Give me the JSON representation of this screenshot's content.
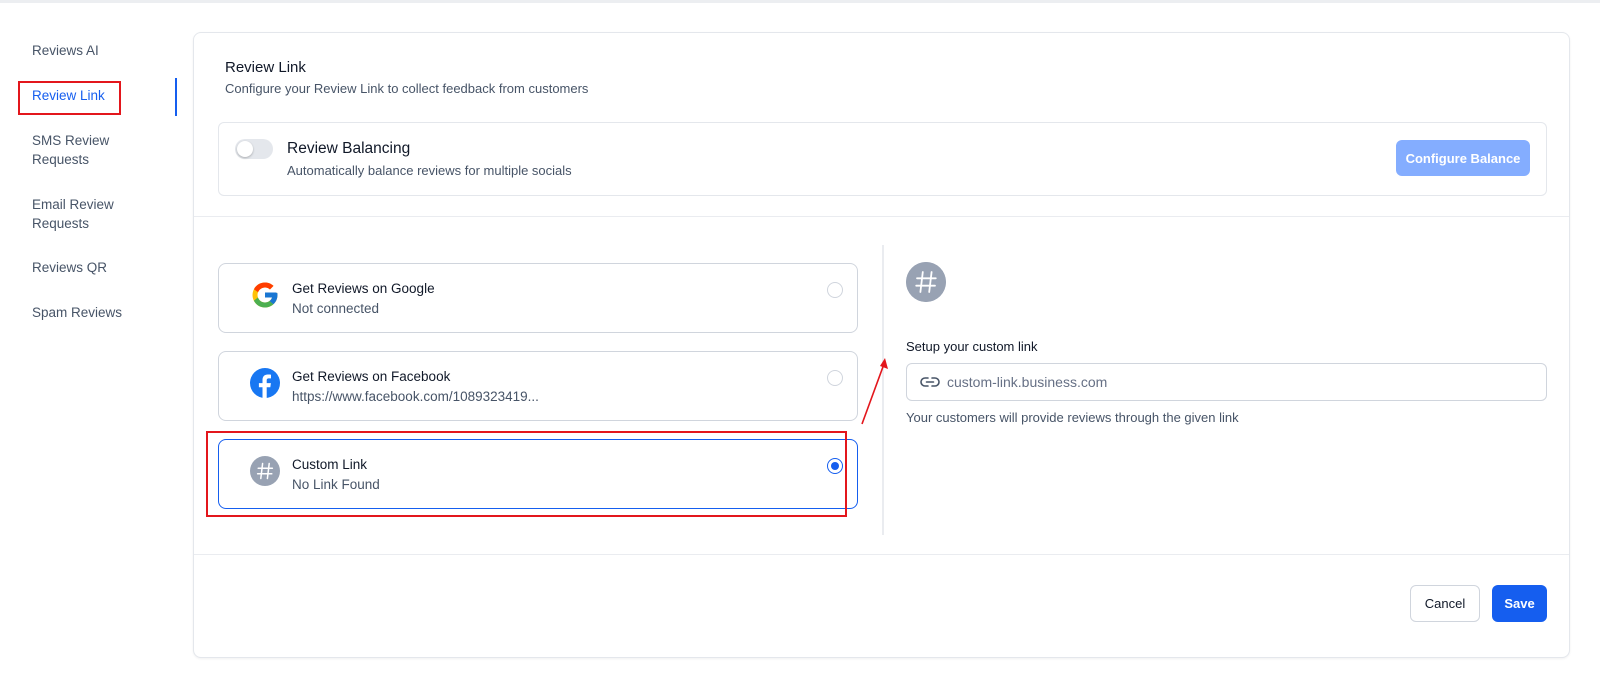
{
  "sidebar": {
    "items": [
      {
        "label": "Reviews AI"
      },
      {
        "label": "Review Link"
      },
      {
        "label": "SMS Review Requests"
      },
      {
        "label": "Email Review Requests"
      },
      {
        "label": "Reviews QR"
      },
      {
        "label": "Spam Reviews"
      }
    ],
    "active_item": "Review Link"
  },
  "header": {
    "title": "Review Link",
    "subtitle": "Configure your Review Link to collect feedback from customers"
  },
  "balancing": {
    "title": "Review Balancing",
    "subtitle": "Automatically balance reviews for multiple socials",
    "enabled": false,
    "button_label": "Configure Balance"
  },
  "options": [
    {
      "title": "Get Reviews on Google",
      "subtitle": "Not connected",
      "icon": "google-icon",
      "selected": false
    },
    {
      "title": "Get Reviews on Facebook",
      "subtitle": "https://www.facebook.com/1089323419...",
      "icon": "facebook-icon",
      "selected": false
    },
    {
      "title": "Custom Link",
      "subtitle": "No Link Found",
      "icon": "hash-icon",
      "selected": true
    }
  ],
  "custom_link": {
    "label": "Setup your custom link",
    "value": "",
    "placeholder": "custom-link.business.com",
    "help": "Your customers will provide reviews through the given link"
  },
  "footer": {
    "cancel_label": "Cancel",
    "save_label": "Save"
  },
  "colors": {
    "accent": "#155eef",
    "annotation": "#e3161c",
    "disabled_button": "#84adff"
  }
}
